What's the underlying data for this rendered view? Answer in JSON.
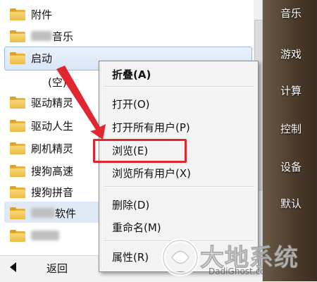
{
  "program_list": {
    "items": [
      {
        "label": "附件"
      },
      {
        "label": "音乐",
        "blurred_prefix": true
      },
      {
        "label": "启动"
      },
      {
        "label": "(空)"
      },
      {
        "label": "驱动精灵"
      },
      {
        "label": "驱动人生"
      },
      {
        "label": "刷机精灵"
      },
      {
        "label": "搜狗高速"
      },
      {
        "label": "搜狗拼音"
      },
      {
        "label": "软件",
        "blurred_prefix": true
      },
      {
        "label": "",
        "blurred_prefix": true
      }
    ],
    "back_label": "返回"
  },
  "right_panel": {
    "items": [
      "音乐",
      "游戏",
      "计算",
      "控制",
      "设备",
      "默认"
    ]
  },
  "context_menu": {
    "items": [
      "折叠(A)",
      "打开(O)",
      "打开所有用户(P)",
      "浏览(E)",
      "浏览所有用户(X)",
      "删除(D)",
      "重命名(M)",
      "属性(R)"
    ]
  },
  "watermark": {
    "name": "大地系统",
    "url": "DadiGhost.com"
  },
  "colors": {
    "highlight_box": "#e0262e",
    "folder": "#edbb44"
  }
}
